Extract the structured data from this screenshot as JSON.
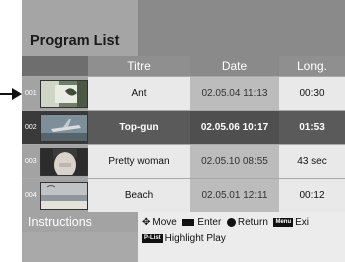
{
  "header": {
    "title": "Program List"
  },
  "table": {
    "columns": [
      "Titre",
      "Date",
      "Long."
    ],
    "rows": [
      {
        "num": "001",
        "title": "Ant",
        "date": "02.05.04 11:13",
        "length": "00:30",
        "thumb": "ant-thumbnail"
      },
      {
        "num": "002",
        "title": "Top-gun",
        "date": "02.05.06 10:17",
        "length": "01:53",
        "thumb": "jet-thumbnail",
        "selected": true
      },
      {
        "num": "003",
        "title": "Pretty woman",
        "date": "02.05.10 08:55",
        "length": "43 sec",
        "thumb": "woman-thumbnail"
      },
      {
        "num": "004",
        "title": "Beach",
        "date": "02.05.01 12:11",
        "length": "00:12",
        "thumb": "beach-thumbnail"
      }
    ]
  },
  "instructions": {
    "label": "Instructions",
    "move": "Move",
    "enter": "Enter",
    "return": "Return",
    "menu_key": "Menu",
    "exit": "Exi",
    "plist_key": "P-List",
    "highlight_play": "Highlight Play"
  },
  "colors": {
    "selected_row": "#5a5a5a",
    "cell_bg": "#e9e9e9",
    "frame": "#a9a9a9"
  }
}
